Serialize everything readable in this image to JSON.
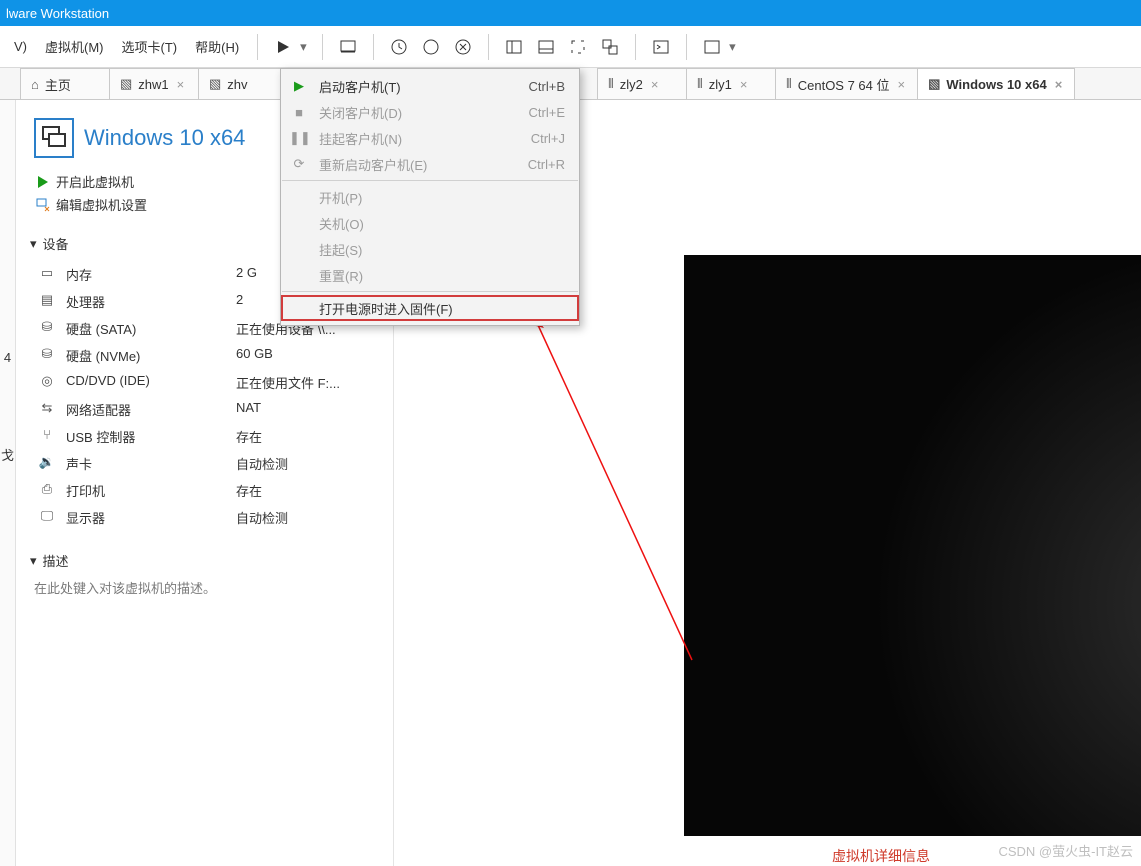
{
  "title_bar": "lware Workstation",
  "menu": {
    "items": [
      "V)",
      "虚拟机(M)",
      "选项卡(T)",
      "帮助(H)"
    ]
  },
  "tabs": [
    {
      "label": "主页",
      "icon": "home",
      "closable": false
    },
    {
      "label": "zhw1",
      "icon": "vm",
      "closable": true
    },
    {
      "label": "zhv",
      "icon": "vm",
      "closable": false
    },
    {
      "label": "zly2",
      "icon": "bars",
      "closable": true
    },
    {
      "label": "zly1",
      "icon": "bars",
      "closable": true
    },
    {
      "label": "CentOS 7 64 位",
      "icon": "bars",
      "closable": true
    },
    {
      "label": "Windows 10 x64",
      "icon": "vm",
      "closable": true,
      "active": true
    }
  ],
  "gutter": [
    "4",
    "戈"
  ],
  "vm": {
    "title": "Windows 10 x64",
    "actions": {
      "power_on": "开启此虚拟机",
      "edit": "编辑虚拟机设置"
    },
    "sections": {
      "devices": "设备",
      "description": "描述"
    },
    "devices": [
      {
        "icon": "memory",
        "name": "内存",
        "value": "2 G"
      },
      {
        "icon": "cpu",
        "name": "处理器",
        "value": "2"
      },
      {
        "icon": "disk",
        "name": "硬盘 (SATA)",
        "value": "正在使用设备 \\\\..."
      },
      {
        "icon": "disk",
        "name": "硬盘 (NVMe)",
        "value": "60 GB"
      },
      {
        "icon": "cd",
        "name": "CD/DVD (IDE)",
        "value": "正在使用文件 F:..."
      },
      {
        "icon": "net",
        "name": "网络适配器",
        "value": "NAT"
      },
      {
        "icon": "usb",
        "name": "USB 控制器",
        "value": "存在"
      },
      {
        "icon": "sound",
        "name": "声卡",
        "value": "自动检测"
      },
      {
        "icon": "printer",
        "name": "打印机",
        "value": "存在"
      },
      {
        "icon": "display",
        "name": "显示器",
        "value": "自动检测"
      }
    ],
    "description_placeholder": "在此处键入对该虚拟机的描述。"
  },
  "dropdown": [
    {
      "type": "item",
      "icon": "play",
      "label": "启动客户机(T)",
      "shortcut": "Ctrl+B",
      "state": "play"
    },
    {
      "type": "item",
      "icon": "stop",
      "label": "关闭客户机(D)",
      "shortcut": "Ctrl+E",
      "state": "disabled"
    },
    {
      "type": "item",
      "icon": "pause",
      "label": "挂起客户机(N)",
      "shortcut": "Ctrl+J",
      "state": "disabled"
    },
    {
      "type": "item",
      "icon": "refresh",
      "label": "重新启动客户机(E)",
      "shortcut": "Ctrl+R",
      "state": "disabled"
    },
    {
      "type": "sep"
    },
    {
      "type": "item",
      "icon": "",
      "label": "开机(P)",
      "shortcut": "",
      "state": "disabled"
    },
    {
      "type": "item",
      "icon": "",
      "label": "关机(O)",
      "shortcut": "",
      "state": "disabled"
    },
    {
      "type": "item",
      "icon": "",
      "label": "挂起(S)",
      "shortcut": "",
      "state": "disabled"
    },
    {
      "type": "item",
      "icon": "",
      "label": "重置(R)",
      "shortcut": "",
      "state": "disabled"
    },
    {
      "type": "sep"
    },
    {
      "type": "item",
      "icon": "",
      "label": "打开电源时进入固件(F)",
      "shortcut": "",
      "state": "highlight"
    }
  ],
  "bottom_text": "虚拟机详细信息",
  "watermark": "CSDN @萤火虫-IT赵云"
}
